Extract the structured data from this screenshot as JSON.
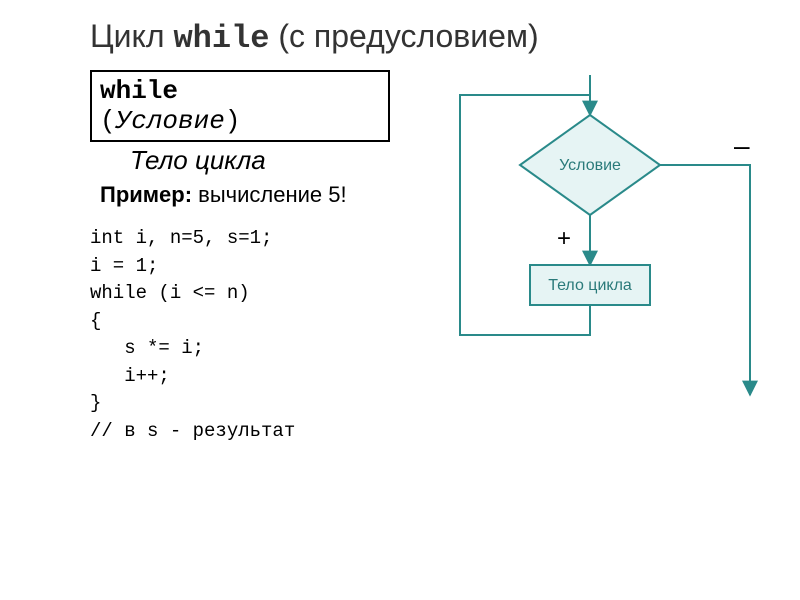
{
  "title": {
    "prefix": "Цикл ",
    "mono": "while",
    "suffix": " (с предусловием)"
  },
  "syntax": {
    "kw": "while",
    "open": "(",
    "cond": "Условие",
    "close": ")"
  },
  "body_label": "Тело цикла",
  "example_label_bold": "Пример:",
  "example_label_rest": " вычисление 5!",
  "code_lines": "int i, n=5, s=1;\ni = 1;\nwhile (i <= n)\n{\n   s *= i;\n   i++;\n}\n// в s - результат",
  "flowchart": {
    "condition": "Условие",
    "body": "Тело цикла",
    "true_label": "+",
    "false_label": "–"
  }
}
